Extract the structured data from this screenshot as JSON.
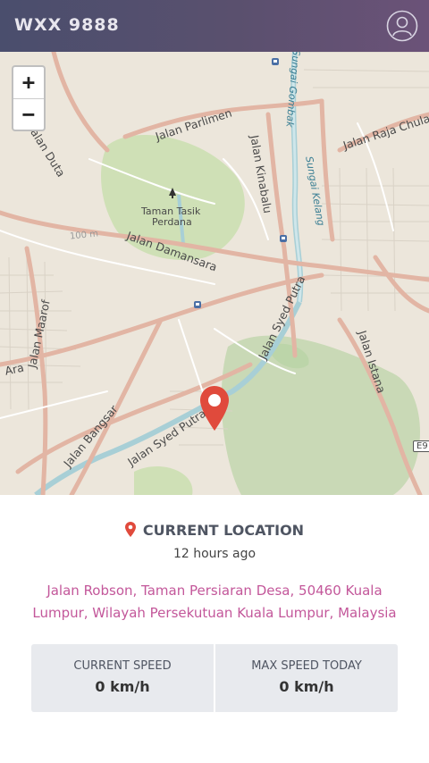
{
  "header": {
    "plate": "WXX 9888",
    "profile_icon": "user-circle-icon"
  },
  "map": {
    "zoom_in": "+",
    "zoom_out": "−",
    "labels": {
      "jalan_duta": "Jalan Duta",
      "jalan_parlimen": "Jalan Parlimen",
      "jalan_kinabalu": "Jalan Kinabalu",
      "sungai_gombak": "Sungai Gombak",
      "sungai_kelang": "Sungai Kelang",
      "jalan_raja_chulan": "Jalan Raja Chulan",
      "taman_1": "Taman Tasik",
      "taman_2": "Perdana",
      "hundred_m": "100 m",
      "jalan_damansara": "Jalan Damansara",
      "jalan_maarof": "Jalan Maarof",
      "ara": "Ara",
      "jalan_bangsar": "Jalan Bangsar",
      "jalan_syed_putra_1": "Jalan Syed Putra",
      "jalan_syed_putra_2": "Jalan Syed Putra",
      "jalan_istana": "Jalan Istana",
      "e9": "E9"
    },
    "marker_icon": "map-pin-icon"
  },
  "location": {
    "title": "CURRENT LOCATION",
    "time_ago": "12 hours ago",
    "address_line1": "Jalan Robson, Taman Persiaran Desa, 50460 Kuala",
    "address_line2": "Lumpur, Wilayah Persekutuan Kuala Lumpur, Malaysia"
  },
  "stats": {
    "current_speed_label": "CURRENT SPEED",
    "current_speed_value": "0 km/h",
    "max_speed_label": "MAX SPEED TODAY",
    "max_speed_value": "0 km/h"
  },
  "colors": {
    "accent": "#c3579a",
    "marker": "#e04a3c",
    "header": "#4a4e6d"
  }
}
